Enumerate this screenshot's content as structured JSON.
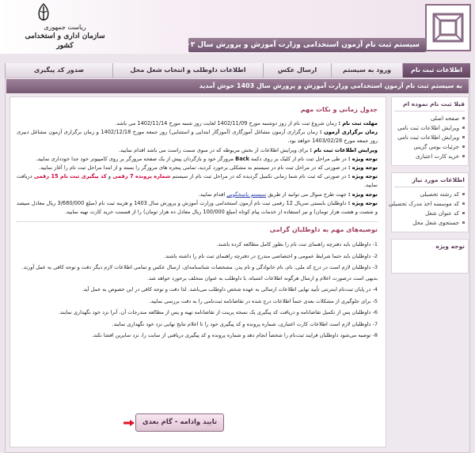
{
  "header": {
    "brand_line1": "ریاست جمهوری",
    "brand_line2": "سازمان اداری و استخدامی کشور",
    "title": "سیستم ثبت نام آزمون استخدامی وزارت آموزش و پرورش سال ۱۴۰۳",
    "accent": "#6e5470"
  },
  "nav": {
    "tabs": [
      {
        "label": "اطلاعات ثبت نام",
        "active": true
      },
      {
        "label": "ورود به سیستم"
      },
      {
        "label": "ارسال عکس"
      },
      {
        "label": "اطلاعات داوطلب و انتخاب شغل محل"
      },
      {
        "label": "صدور کد پیگیری"
      }
    ]
  },
  "welcome": "به سیستم ثبت نام آزمون استخدامی وزارت آموزش و پرورش سال 1403 خوش آمدید",
  "sidebar": {
    "box1": {
      "title": "قبلا ثبت نام نموده ام",
      "items": [
        "صفحه اصلی",
        "ویرایش اطلاعات ثبت نامی",
        "ویرایش اطلاعات ثبت نامی",
        "جزئیات بومی گزینی",
        "خرید کارت اعتباری"
      ]
    },
    "box2": {
      "title": "اطلاعات مورد نیاز",
      "items": [
        "کد رشته تحصیلی",
        "کد موسسه اخذ مدرک تحصیلی",
        "کد عنوان شغل",
        "جستجوی شغل محل"
      ]
    },
    "box3": {
      "title": "توجه ویژه"
    }
  },
  "content": {
    "section1_title": "جدول زمانی و نکات مهم",
    "p1_label": "مهلت ثبت نام :",
    "p1_text": " زمان شروع ثبت نام از روز دوشنبه مورخ 1402/11/09 لغایت روز شنبه مورخ 1402/11/14 می باشد.",
    "p2_label": "زمان برگزاری آزمون :",
    "p2_text": " زمان برگزاری آزمون مشاغل آموزگاری (آموزگار ابتدایی و استثنایی) روز جمعه مورخ 1402/12/18 و زمان برگزاری آزمون مشاغل دبیری روز جمعه مورخ 1403/02/28 خواهد بود.",
    "p3_label": "ویرایش اطلاعات ثبت نام :",
    "p3_text": " برای ویرایش اطلاعات از بخش مربوطه که در منوی سمت راست می باشد اقدام نمایید.",
    "p4_label": "توجه ویژه :",
    "p4_text_a": " در طی مراحل ثبت نام از کلیک بر روی دکمه ",
    "p4_back": "Back",
    "p4_text_b": " مرورگر خود و بازگردان پیش از یک صفحه مرورگر بر روی کامپیوتر خود جدا خودداری نمایید.",
    "p5_label": "توجه ویژه :",
    "p5_text": " در صورتی که در مراحل ثبت نام در سیستم به مشکلی برخورد کردید، تمامی پنجره های مرورگر را بسته و از ابتدا مراحل ثبت نام را آغاز نمایید.",
    "p6_label": "توجه ویژه :",
    "p6_text_a": " در صورتی که ثبت نام شما زمانی تکمیل گردیده که در مراحل ثبت نام از سیستم ",
    "p6_red_a": "شماره پرونده 7 رقمی",
    "p6_text_b": " و ",
    "p6_red_b": "کد پیگیری ثبت نام 15 رقمی",
    "p6_text_c": " دریافت نمایید.",
    "p7_label": "توجه ویژه :",
    "p7_text_a": " جهت طرح سوال می توانید از طریق ",
    "p7_link": "سیستم پاسخگویی",
    "p7_text_b": " اقدام نمایید.",
    "p8_label": "توجه ویژه :",
    "p8_text": " داوطلبان بایستی سریال 12 رقمی ثبت نام آزمون استخدامی وزارت آموزش و پرورش سال 1403 و هزینه ثبت نام (مبلغ 3/680/000 ریال معادل سیصد و شصت و هشت هزار تومان) و نیز استفاده از خدمات پیام کوتاه (مبلغ 100/000 ریال معادل ده هزار تومان) را از قسمت خرید کارت تهیه نمایید.",
    "section2_title": "توصیه‌های مهم به داوطلبان گرامی",
    "list": [
      "1- داوطلبان باید دفترچه راهنمای ثبت نام را بطور کامل مطالعه کرده باشند.",
      "2- داوطلبان باید حتما شرایط عمومی و اختصاصی مندرج در دفترچه راهنمای ثبت نام را داشته باشند.",
      "3- داوطلبان لازم است در درج کد ملی، نام، نام خانوادگی و نام پدر، مشخصات شناسنامه‌ای، ارسال عکس و تمامی اطلاعات لازم دیگر دقت و توجه کافی به عمل آورند. بدیهی است درصورت اعلام و ارسال هرگونه اطلاعات اشتباه، با داوطلب به عنوان متخلف برخورد خواهد شد.",
      "4- در پایان ثبت‌نام اینترنتی تأیید نهایی اطلاعات ارسالی به عهده شخص داوطلب می‌باشد. لذا دقت و توجه کافی در این خصوص به عمل آید.",
      "5- برای جلوگیری از مشکلات بعدی حتماً اطلاعات درج شده در تقاضانامه ثبت‌نامی را به دقت بررسی نمایید.",
      "6- داوطلبان پس از تکمیل تقاضانامه و دریافت کد پیگیری یک نسخه پرینت از تقاضانامه تهیه و پس از مطالعه مندرجات آن، آنرا نزد خود نگهداری نمایند.",
      "7- داوطلبان لازم است اطلاعات کارت اعتباری، شماره پرونده و کد پیگیری خود را تا اعلام نتایج نهایی نزد خود نگهداری نمایند.",
      "8- توصیه می‌شود داوطلبان فرایند ثبت‌نام را شخصاً انجام دهد و شماره پرونده و کد پیگیری دریافتی از سایت را، نزد سایرین افشا نکند."
    ],
    "next_button": "تایید وادامه - گام بعدی"
  }
}
